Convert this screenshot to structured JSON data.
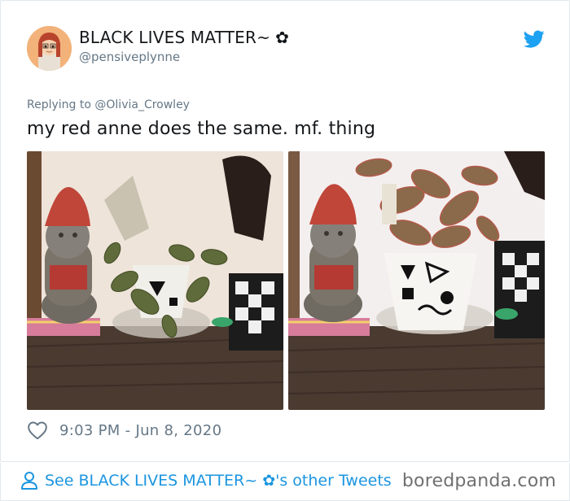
{
  "tweet": {
    "display_name": "BLACK LIVES MATTER~",
    "name_flower": "✿",
    "handle": "@pensiveplynne",
    "replying_prefix": "Replying to",
    "replying_to": "@Olivia_Crowley",
    "text": "my red anne does the same. mf. thing",
    "time": "9:03 PM - Jun 8, 2020",
    "photos": [
      {
        "description_icon": "gnome-with-wilted-plant-photo"
      },
      {
        "description_icon": "gnome-with-healthy-plant-photo"
      }
    ]
  },
  "footer": {
    "see_more": "See BLACK LIVES MATTER~ ✿'s other Tweets",
    "watermark": "boredpanda.com"
  },
  "colors": {
    "link": "#1b95e0",
    "muted": "#657786",
    "text": "#14171a",
    "twitter_blue": "#1da1f2"
  }
}
